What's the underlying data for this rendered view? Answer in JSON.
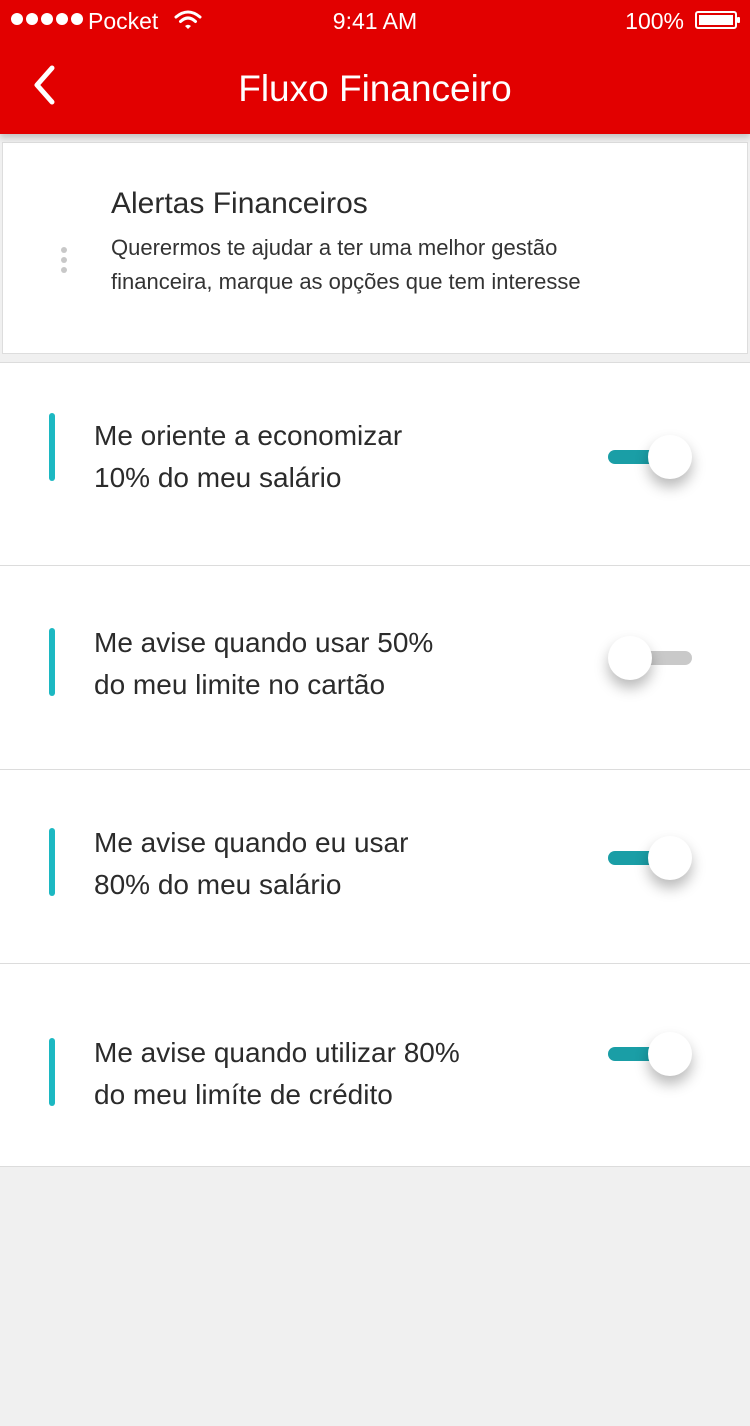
{
  "status_bar": {
    "carrier": "Pocket",
    "time": "9:41 AM",
    "battery": "100%"
  },
  "header": {
    "title": "Fluxo Financeiro",
    "back_icon": "chevron-left-icon",
    "background_color": "#e20000"
  },
  "intro": {
    "title": "Alertas Financeiros",
    "line1": "Querermos te ajudar a ter uma melhor gestão",
    "line2": "financeira, marque as opções que tem interesse"
  },
  "alerts": [
    {
      "line1": "Me oriente a economizar",
      "line2": "10% do meu salário",
      "enabled": true
    },
    {
      "line1": "Me avise quando usar 50%",
      "line2": "do meu limite no cartão",
      "enabled": false
    },
    {
      "line1": "Me avise quando eu usar",
      "line2": "80% do meu salário",
      "enabled": true
    },
    {
      "line1": "Me avise quando utilizar 80%",
      "line2": "do meu limíte de crédito",
      "enabled": true
    }
  ],
  "colors": {
    "accent": "#1cb8c2",
    "toggle_on": "#1a9ea6",
    "toggle_off": "#c9c9c9"
  }
}
